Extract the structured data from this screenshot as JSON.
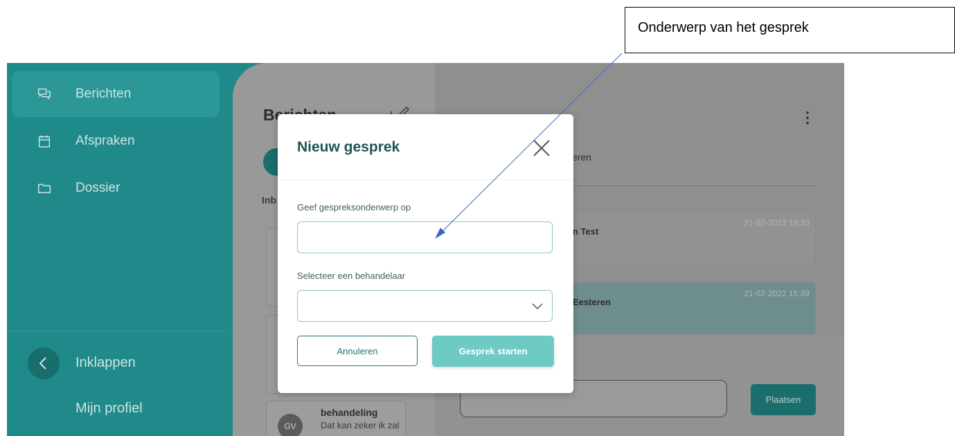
{
  "sidebar": {
    "items": [
      {
        "label": "Berichten",
        "icon": "chat-bubbles-icon",
        "active": true
      },
      {
        "label": "Afspraken",
        "icon": "calendar-icon",
        "active": false
      },
      {
        "label": "Dossier",
        "icon": "folder-icon",
        "active": false
      }
    ],
    "collapse_label": "Inklappen",
    "profile_label": "Mijn profiel"
  },
  "list": {
    "title": "Berichten",
    "inbox_label": "Inb",
    "bottom_card": {
      "avatar": "GV",
      "title": "behandeling",
      "snippet": "Dat kan zeker ik zal"
    }
  },
  "conversation": {
    "header": "eren",
    "messages": [
      {
        "from": "n Test",
        "time": "21-02-2022 15:33"
      },
      {
        "from": "Eesteren",
        "time": "21-02-2022 15:39"
      }
    ],
    "post_label": "Plaatsen"
  },
  "modal": {
    "title": "Nieuw gesprek",
    "subject_label": "Geef gespreksonderwerp op",
    "subject_value": "",
    "practitioner_label": "Selecteer een behandelaar",
    "practitioner_value": "",
    "cancel_label": "Annuleren",
    "start_label": "Gesprek starten"
  },
  "annotation": {
    "text": "Onderwerp van het gesprek"
  },
  "colors": {
    "brand": "#1f8a89",
    "accent": "#6ecac5",
    "title": "#1d5654"
  }
}
